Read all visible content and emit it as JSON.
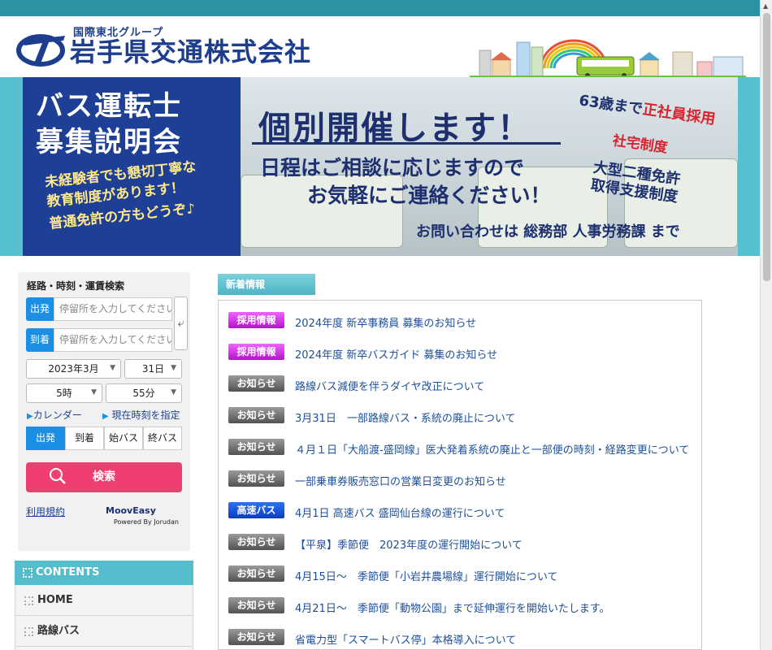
{
  "header": {
    "group_name": "国際東北グループ",
    "company_name": "岩手県交通株式会社"
  },
  "banner": {
    "left_title_1": "バス運転士",
    "left_title_2": "募集説明会",
    "left_sub_1": "未経験者でも懇切丁寧な",
    "left_sub_2": "教育制度があります！",
    "left_sub_3": "普通免許の方もどうぞ♪",
    "headline": "個別開催します！",
    "line1": "日程はご相談に応じますので",
    "line2": "お気軽にご連絡ください！",
    "contact": "お問い合わせは 総務部 人事労務課 まで",
    "point1_a": "63歳まで",
    "point1_b": "正社員採用",
    "point2": "社宅制度",
    "point3_a": "大型二種免許",
    "point3_b": "取得支援制度"
  },
  "search": {
    "title": "経路・時刻・運賃検索",
    "from_tag": "出発",
    "to_tag": "到着",
    "from_placeholder": "停留所を入力してください",
    "to_placeholder": "停留所を入力してください",
    "year_month": "2023年3月",
    "day": "31日",
    "hour": "5時",
    "minute": "55分",
    "calendar_link": "カレンダー",
    "now_link": "現在時刻を指定",
    "modes": [
      "出発",
      "到着",
      "始バス",
      "終バス"
    ],
    "search_button": "検索",
    "terms_link": "利用規約",
    "brand": "MoovEasy",
    "powered": "Powered By Jorudan"
  },
  "contents": {
    "heading": "CONTENTS",
    "items": [
      "HOME",
      "路線バス"
    ]
  },
  "news": {
    "tab": "新着情報",
    "items": [
      {
        "badge": "採用情報",
        "type": "recruit",
        "title": "2024年度 新卒事務員 募集のお知らせ"
      },
      {
        "badge": "採用情報",
        "type": "recruit",
        "title": "2024年度 新卒バスガイド 募集のお知らせ"
      },
      {
        "badge": "お知らせ",
        "type": "info",
        "title": "路線バス減便を伴うダイヤ改正について"
      },
      {
        "badge": "お知らせ",
        "type": "info",
        "title": "3月31日　一部路線バス・系統の廃止について"
      },
      {
        "badge": "お知らせ",
        "type": "info",
        "title": "４月１日「大船渡-盛岡線」医大発着系統の廃止と一部便の時刻・経路変更について"
      },
      {
        "badge": "お知らせ",
        "type": "info",
        "title": "一部乗車券販売窓口の営業日変更のお知らせ"
      },
      {
        "badge": "高速バス",
        "type": "express",
        "title": "4月1日 高速バス 盛岡仙台線の運行について"
      },
      {
        "badge": "お知らせ",
        "type": "info",
        "title": "【平泉】季節便　2023年度の運行開始について"
      },
      {
        "badge": "お知らせ",
        "type": "info",
        "title": "4月15日～　季節便「小岩井農場線」運行開始について"
      },
      {
        "badge": "お知らせ",
        "type": "info",
        "title": "4月21日～　季節便「動物公園」まで延伸運行を開始いたします。"
      },
      {
        "badge": "お知らせ",
        "type": "info",
        "title": "省電力型「スマートバス停」本格導入について"
      }
    ]
  },
  "colors": {
    "top_bar": "#2c93a3",
    "brand_navy": "#1d3d8f",
    "search_accent": "#1a8fe3",
    "search_button": "#ef3f71",
    "news_link": "#1d4f99"
  }
}
